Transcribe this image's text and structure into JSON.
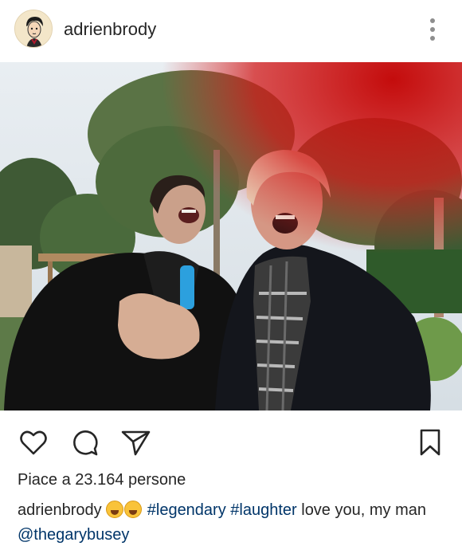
{
  "post": {
    "username": "adrienbrody",
    "likes_text": "Piace a 23.164 persone",
    "caption": {
      "username": "adrienbrody",
      "emojis": [
        "rolling-on-floor-laughing",
        "grinning-squinting-face"
      ],
      "tag1": "#legendary",
      "tag2": "#laughter",
      "text": " love you, my man ",
      "mention": "@thegarybusey"
    }
  },
  "icons": {
    "avatar": "avatar-illustration",
    "more": "more-options-icon",
    "like": "heart-icon",
    "comment": "comment-icon",
    "share": "send-icon",
    "save": "bookmark-icon"
  }
}
